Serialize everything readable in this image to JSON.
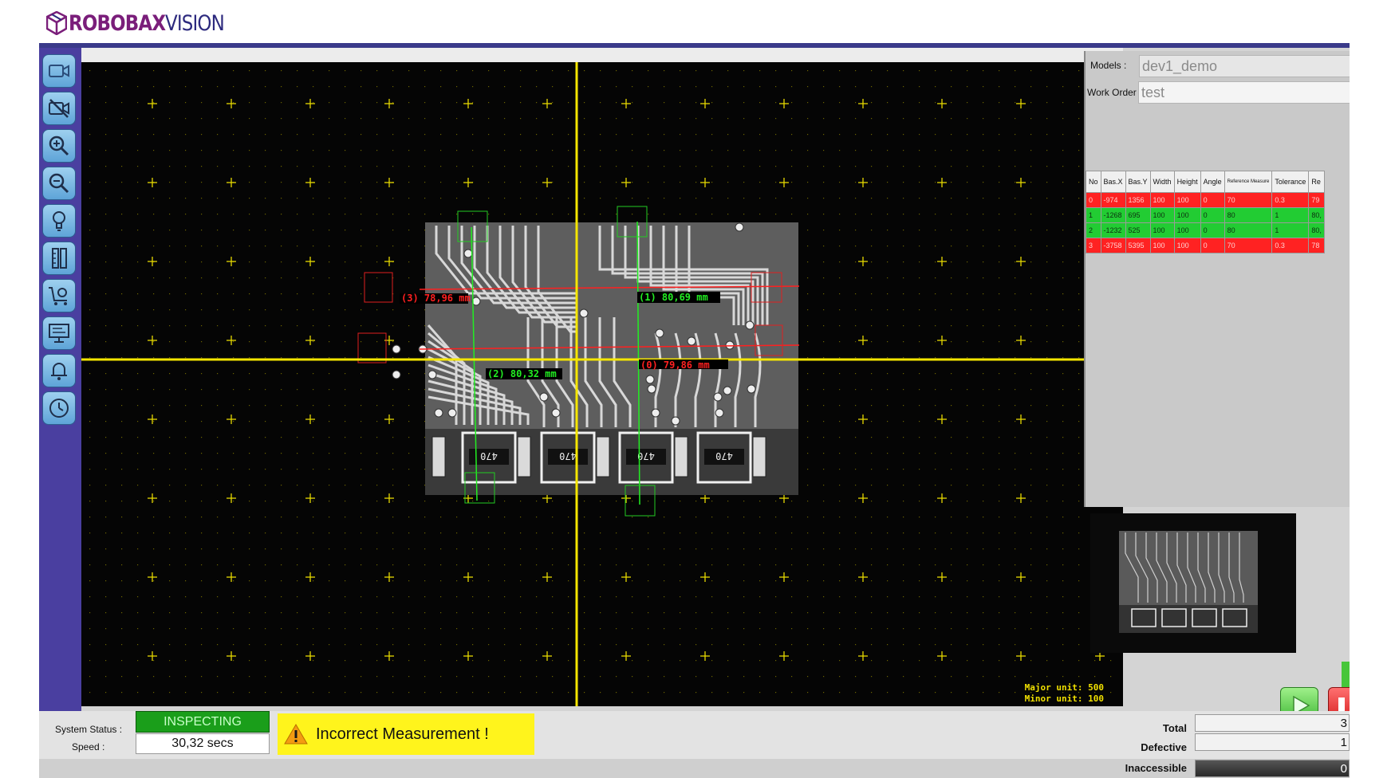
{
  "brand": {
    "word1": "ROBOBAX",
    "word2": "VISION"
  },
  "toolbar": {
    "tools": [
      {
        "name": "camera-icon"
      },
      {
        "name": "camera-off-icon"
      },
      {
        "name": "zoom-in-icon"
      },
      {
        "name": "zoom-out-icon"
      },
      {
        "name": "lightbulb-icon"
      },
      {
        "name": "ruler-icon"
      },
      {
        "name": "cart-settings-icon"
      },
      {
        "name": "monitor-icon"
      },
      {
        "name": "bell-icon"
      },
      {
        "name": "clock-icon"
      }
    ]
  },
  "camera": {
    "measurements": [
      {
        "label": "(3) 78,96 mm",
        "color": "#ff2020"
      },
      {
        "label": "(1) 80,69 mm",
        "color": "#22ee22"
      },
      {
        "label": "(2) 80,32 mm",
        "color": "#22ee22"
      },
      {
        "label": "(0) 79,86 mm",
        "color": "#ff2020"
      }
    ],
    "board_labels": [
      "470",
      "470",
      "470",
      "470"
    ],
    "major_unit": "Major unit: 500",
    "minor_unit": "Minor unit: 100"
  },
  "panel": {
    "models_label": "Models :",
    "models_value": "dev1_demo",
    "work_order_label": "Work Order :",
    "work_order_value": "test"
  },
  "table": {
    "columns": [
      "No",
      "Bas.X",
      "Bas.Y",
      "Width",
      "Height",
      "Angle",
      "Reference Measure",
      "Tolerance",
      "Re"
    ],
    "rows": [
      {
        "status": "red",
        "cells": [
          "0",
          "-974",
          "1356",
          "100",
          "100",
          "0",
          "70",
          "0.3",
          "79"
        ]
      },
      {
        "status": "green",
        "cells": [
          "1",
          "-1268",
          "695",
          "100",
          "100",
          "0",
          "80",
          "1",
          "80,"
        ]
      },
      {
        "status": "green",
        "cells": [
          "2",
          "-1232",
          "525",
          "100",
          "100",
          "0",
          "80",
          "1",
          "80,"
        ]
      },
      {
        "status": "red",
        "cells": [
          "3",
          "-3758",
          "5395",
          "100",
          "100",
          "0",
          "70",
          "0.3",
          "78"
        ]
      }
    ]
  },
  "status": {
    "system_status_label": "System Status :",
    "system_status_value": "INSPECTING",
    "speed_label": "Speed :",
    "speed_value": "30,32 secs",
    "alert_text": "Incorrect Measurement !",
    "total_label": "Total",
    "total_value": "3",
    "defective_label": "Defective",
    "defective_value": "1",
    "inaccessible_label": "Inaccessible",
    "inaccessible_value": "0"
  },
  "colors": {
    "toolbar": "#4a3fa0",
    "status_ok": "#1a9e1a",
    "alert": "#fff41c",
    "crosshair": "#f5e600",
    "fail": "#ff2222",
    "pass": "#22cc33"
  }
}
